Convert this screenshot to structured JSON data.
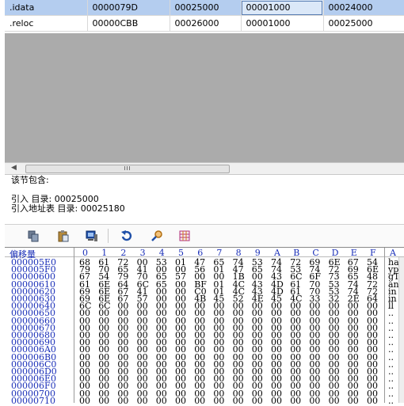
{
  "sections_table": {
    "rows": [
      {
        "name": ".idata",
        "vsize": "0000079D",
        "voffset": "00025000",
        "rsize": "00001000",
        "roffset": "00024000",
        "selected": true
      },
      {
        "name": ".reloc",
        "vsize": "00000CBB",
        "voffset": "00026000",
        "rsize": "00001000",
        "roffset": "00025000",
        "selected": false
      }
    ]
  },
  "hscroll": {
    "thumb_text": "III"
  },
  "info_panel": {
    "title": "该节包含:",
    "lines": [
      "引入 目录: 00025000",
      "引入地址表 目录: 00025180"
    ]
  },
  "toolbar": {
    "icons": [
      "copy-icon",
      "paste-icon",
      "computer-icon",
      "refresh-icon",
      "search-icon",
      "grid-icon"
    ],
    "colors": {
      "blue": "#1f4fa8",
      "gray": "#6e6e6e",
      "orange": "#d77a1a",
      "magenta": "#b0307a"
    }
  },
  "hex_view": {
    "offset_header": "偏移量",
    "column_headers": [
      "0",
      "1",
      "2",
      "3",
      "4",
      "5",
      "6",
      "7",
      "8",
      "9",
      "A",
      "B",
      "C",
      "D",
      "E",
      "F"
    ],
    "ascii_header": "A",
    "rows": [
      {
        "offset": "000005E0",
        "bytes": [
          "68",
          "61",
          "72",
          "00",
          "53",
          "01",
          "47",
          "65",
          "74",
          "53",
          "74",
          "72",
          "69",
          "6E",
          "67",
          "54"
        ],
        "ascii": "ha"
      },
      {
        "offset": "000005F0",
        "bytes": [
          "79",
          "70",
          "65",
          "41",
          "00",
          "00",
          "56",
          "01",
          "47",
          "65",
          "74",
          "53",
          "74",
          "72",
          "69",
          "6E"
        ],
        "ascii": "yp"
      },
      {
        "offset": "00000600",
        "bytes": [
          "67",
          "54",
          "79",
          "70",
          "65",
          "57",
          "00",
          "00",
          "1B",
          "00",
          "43",
          "6C",
          "6F",
          "73",
          "65",
          "48"
        ],
        "ascii": "gT"
      },
      {
        "offset": "00000610",
        "bytes": [
          "61",
          "6E",
          "64",
          "6C",
          "65",
          "00",
          "BF",
          "01",
          "4C",
          "43",
          "4D",
          "61",
          "70",
          "53",
          "74",
          "72"
        ],
        "ascii": "an"
      },
      {
        "offset": "00000620",
        "bytes": [
          "69",
          "6E",
          "67",
          "41",
          "00",
          "00",
          "C0",
          "01",
          "4C",
          "43",
          "4D",
          "61",
          "70",
          "53",
          "74",
          "72"
        ],
        "ascii": "in"
      },
      {
        "offset": "00000630",
        "bytes": [
          "69",
          "6E",
          "67",
          "57",
          "00",
          "00",
          "4B",
          "45",
          "52",
          "4E",
          "45",
          "4C",
          "33",
          "32",
          "2E",
          "64"
        ],
        "ascii": "in"
      },
      {
        "offset": "00000640",
        "bytes": [
          "6C",
          "6C",
          "00",
          "00",
          "00",
          "00",
          "00",
          "00",
          "00",
          "00",
          "00",
          "00",
          "00",
          "00",
          "00",
          "00"
        ],
        "ascii": "ll"
      },
      {
        "offset": "00000650",
        "bytes": [
          "00",
          "00",
          "00",
          "00",
          "00",
          "00",
          "00",
          "00",
          "00",
          "00",
          "00",
          "00",
          "00",
          "00",
          "00",
          "00"
        ],
        "ascii": ".."
      },
      {
        "offset": "00000660",
        "bytes": [
          "00",
          "00",
          "00",
          "00",
          "00",
          "00",
          "00",
          "00",
          "00",
          "00",
          "00",
          "00",
          "00",
          "00",
          "00",
          "00"
        ],
        "ascii": ".."
      },
      {
        "offset": "00000670",
        "bytes": [
          "00",
          "00",
          "00",
          "00",
          "00",
          "00",
          "00",
          "00",
          "00",
          "00",
          "00",
          "00",
          "00",
          "00",
          "00",
          "00"
        ],
        "ascii": ".."
      },
      {
        "offset": "00000680",
        "bytes": [
          "00",
          "00",
          "00",
          "00",
          "00",
          "00",
          "00",
          "00",
          "00",
          "00",
          "00",
          "00",
          "00",
          "00",
          "00",
          "00"
        ],
        "ascii": ".."
      },
      {
        "offset": "00000690",
        "bytes": [
          "00",
          "00",
          "00",
          "00",
          "00",
          "00",
          "00",
          "00",
          "00",
          "00",
          "00",
          "00",
          "00",
          "00",
          "00",
          "00"
        ],
        "ascii": ".."
      },
      {
        "offset": "000006A0",
        "bytes": [
          "00",
          "00",
          "00",
          "00",
          "00",
          "00",
          "00",
          "00",
          "00",
          "00",
          "00",
          "00",
          "00",
          "00",
          "00",
          "00"
        ],
        "ascii": ".."
      },
      {
        "offset": "000006B0",
        "bytes": [
          "00",
          "00",
          "00",
          "00",
          "00",
          "00",
          "00",
          "00",
          "00",
          "00",
          "00",
          "00",
          "00",
          "00",
          "00",
          "00"
        ],
        "ascii": ".."
      },
      {
        "offset": "000006C0",
        "bytes": [
          "00",
          "00",
          "00",
          "00",
          "00",
          "00",
          "00",
          "00",
          "00",
          "00",
          "00",
          "00",
          "00",
          "00",
          "00",
          "00"
        ],
        "ascii": ".."
      },
      {
        "offset": "000006D0",
        "bytes": [
          "00",
          "00",
          "00",
          "00",
          "00",
          "00",
          "00",
          "00",
          "00",
          "00",
          "00",
          "00",
          "00",
          "00",
          "00",
          "00"
        ],
        "ascii": ".."
      },
      {
        "offset": "000006E0",
        "bytes": [
          "00",
          "00",
          "00",
          "00",
          "00",
          "00",
          "00",
          "00",
          "00",
          "00",
          "00",
          "00",
          "00",
          "00",
          "00",
          "00"
        ],
        "ascii": ".."
      },
      {
        "offset": "000006F0",
        "bytes": [
          "00",
          "00",
          "00",
          "00",
          "00",
          "00",
          "00",
          "00",
          "00",
          "00",
          "00",
          "00",
          "00",
          "00",
          "00",
          "00"
        ],
        "ascii": ".."
      },
      {
        "offset": "00000700",
        "bytes": [
          "00",
          "00",
          "00",
          "00",
          "00",
          "00",
          "00",
          "00",
          "00",
          "00",
          "00",
          "00",
          "00",
          "00",
          "00",
          "00"
        ],
        "ascii": ".."
      },
      {
        "offset": "00000710",
        "bytes": [
          "00",
          "00",
          "00",
          "00",
          "00",
          "00",
          "00",
          "00",
          "00",
          "00",
          "00",
          "00",
          "00",
          "00",
          "00",
          "00"
        ],
        "ascii": ".."
      }
    ]
  }
}
